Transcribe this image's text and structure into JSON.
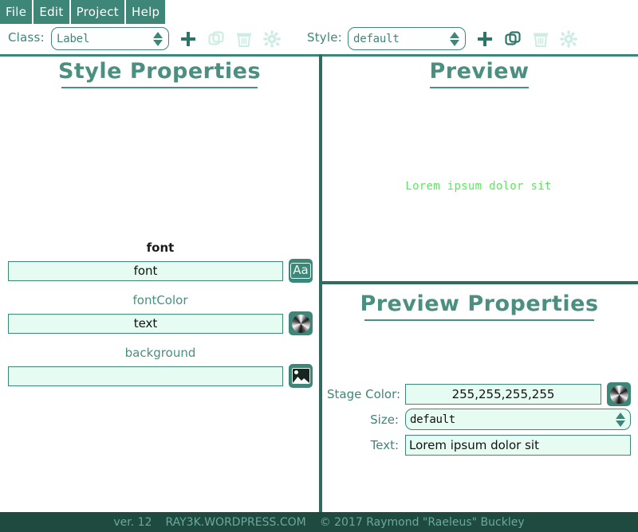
{
  "menubar": {
    "items": [
      {
        "label": "File",
        "name": "menu-file"
      },
      {
        "label": "Edit",
        "name": "menu-edit"
      },
      {
        "label": "Project",
        "name": "menu-project"
      },
      {
        "label": "Help",
        "name": "menu-help"
      }
    ]
  },
  "toolbar": {
    "class_label": "Class:",
    "class_value": "Label",
    "style_label": "Style:",
    "style_value": "default",
    "class_icons": [
      "plus-icon",
      "duplicate-icon",
      "trash-icon",
      "gear-icon"
    ],
    "style_icons": [
      "plus-icon",
      "duplicate-icon",
      "trash-icon",
      "gear-icon"
    ]
  },
  "style_panel": {
    "heading": "Style Properties",
    "properties": [
      {
        "label": "font",
        "value": "font",
        "button_icon": "font-icon"
      },
      {
        "label": "fontColor",
        "value": "text",
        "button_icon": "color-wheel-icon"
      },
      {
        "label": "background",
        "value": "",
        "button_icon": "image-icon"
      }
    ]
  },
  "preview_panel": {
    "heading": "Preview",
    "sample_text": "Lorem ipsum dolor sit"
  },
  "preview_properties": {
    "heading": "Preview Properties",
    "stage_color_label": "Stage Color:",
    "stage_color_value": "255,255,255,255",
    "stage_color_button_icon": "color-wheel-icon",
    "size_label": "Size:",
    "size_value": "default",
    "text_label": "Text:",
    "text_value": "Lorem ipsum dolor sit"
  },
  "statusbar": {
    "version": "ver. 12",
    "site": "RAY3K.WORDPRESS.COM",
    "copyright": "© 2017 Raymond \"Raeleus\" Buckley"
  },
  "colors": {
    "teal": "#3d8678",
    "teal_dark": "#1f4a40",
    "heading": "#4a8f80",
    "field_bg": "#e6fcf3",
    "preview_green": "#5ce85c"
  }
}
